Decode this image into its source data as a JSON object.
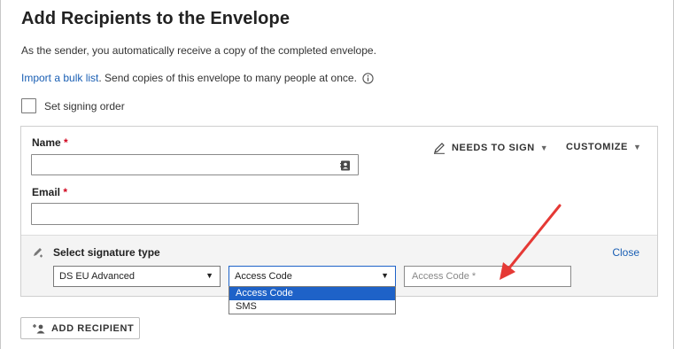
{
  "page": {
    "title": "Add Recipients to the Envelope",
    "subtitle": "As the sender, you automatically receive a copy of the completed envelope.",
    "bulk_link": "Import a bulk list",
    "bulk_text": ". Send copies of this envelope to many people at once.",
    "signing_order_label": "Set signing order"
  },
  "recipient": {
    "name_label": "Name",
    "email_label": "Email",
    "required_mark": "*",
    "name_value": "",
    "email_value": "",
    "action_label": "NEEDS TO SIGN",
    "customize_label": "CUSTOMIZE",
    "caret": "▼"
  },
  "signature": {
    "title": "Select signature type",
    "close_label": "Close",
    "type_value": "DS EU Advanced",
    "auth_value": "Access Code",
    "auth_options": [
      "Access Code",
      "SMS"
    ],
    "access_code_placeholder": "Access Code *",
    "arrow_glyph": "▼"
  },
  "footer": {
    "add_recipient_label": "ADD RECIPIENT"
  },
  "colors": {
    "link": "#1a5fb4",
    "selected": "#1e62c8",
    "required": "#d0021b",
    "annotation_arrow": "#e53935"
  },
  "icons": {
    "info": "info-icon",
    "contact": "contact-card-icon",
    "pen": "pen-icon",
    "signature": "signature-pen-icon",
    "add_user": "add-user-icon"
  }
}
